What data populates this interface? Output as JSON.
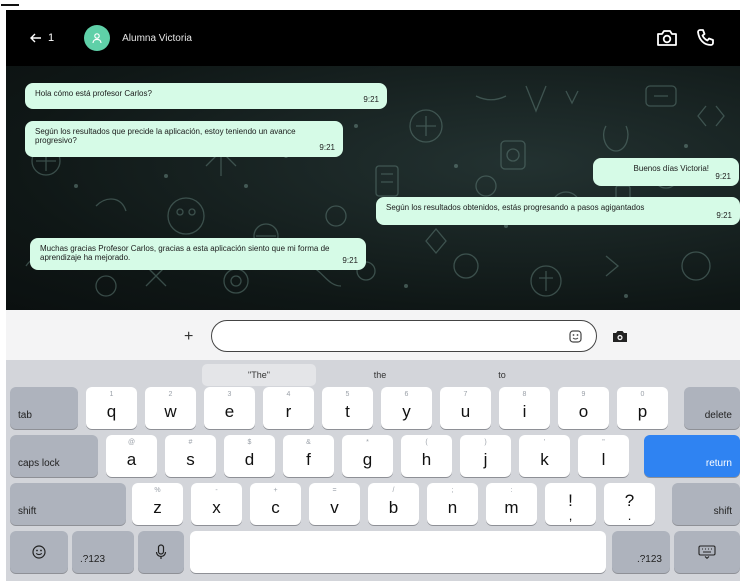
{
  "header": {
    "back_count": "1",
    "contact_name": "Alumna Victoria"
  },
  "messages": [
    {
      "side": "in",
      "text": "Hola cómo está profesor Carlos?",
      "time": "9:21"
    },
    {
      "side": "in",
      "text": "Según los resultados que precide la aplicación, estoy teniendo un avance progresivo?",
      "time": "9:21"
    },
    {
      "side": "out",
      "text": "Buenos días Victoria!",
      "time": "9:21"
    },
    {
      "side": "out",
      "text": "Según los resultados obtenidos, estás progresando a pasos agigantados",
      "time": "9:21"
    },
    {
      "side": "in",
      "text": "Muchas gracias Profesor Carlos, gracias a esta aplicación siento que mi forma de aprendizaje ha mejorado.",
      "time": "9:21"
    }
  ],
  "input": {
    "plus_label": "+",
    "value": "",
    "placeholder": ""
  },
  "keyboard": {
    "suggestions": [
      "\"The\"",
      "the",
      "to"
    ],
    "row1": [
      {
        "main": "q",
        "alt": "1"
      },
      {
        "main": "w",
        "alt": "2"
      },
      {
        "main": "e",
        "alt": "3"
      },
      {
        "main": "r",
        "alt": "4"
      },
      {
        "main": "t",
        "alt": "5"
      },
      {
        "main": "y",
        "alt": "6"
      },
      {
        "main": "u",
        "alt": "7"
      },
      {
        "main": "i",
        "alt": "8"
      },
      {
        "main": "o",
        "alt": "9"
      },
      {
        "main": "p",
        "alt": "0"
      }
    ],
    "row2": [
      {
        "main": "a",
        "alt": "@"
      },
      {
        "main": "s",
        "alt": "#"
      },
      {
        "main": "d",
        "alt": "$"
      },
      {
        "main": "f",
        "alt": "&"
      },
      {
        "main": "g",
        "alt": "*"
      },
      {
        "main": "h",
        "alt": "("
      },
      {
        "main": "j",
        "alt": ")"
      },
      {
        "main": "k",
        "alt": "'"
      },
      {
        "main": "l",
        "alt": "\""
      }
    ],
    "row3": [
      {
        "main": "z",
        "alt": "%"
      },
      {
        "main": "x",
        "alt": "-"
      },
      {
        "main": "c",
        "alt": "+"
      },
      {
        "main": "v",
        "alt": "="
      },
      {
        "main": "b",
        "alt": "/"
      },
      {
        "main": "n",
        "alt": ";"
      },
      {
        "main": "m",
        "alt": ":"
      },
      {
        "main": "!",
        "alt": ""
      },
      {
        "main": "?",
        "alt": ""
      }
    ],
    "row3_sublabels": [
      ",",
      "."
    ],
    "tab": "tab",
    "delete": "delete",
    "caps_lock": "caps lock",
    "return": "return",
    "shift_left": "shift",
    "shift_right": "shift",
    "num_left": ".?123",
    "num_right": ".?123"
  },
  "colors": {
    "bubble": "#d6fbe7",
    "avatar": "#5fd0a8",
    "return_key": "#2f83f2",
    "keyboard_bg": "#d3d5da"
  },
  "icons": [
    "arrow-left-icon",
    "user-icon",
    "camera-icon",
    "phone-icon",
    "sticker-icon",
    "emoji-icon",
    "microphone-icon",
    "keyboard-dismiss-icon"
  ]
}
